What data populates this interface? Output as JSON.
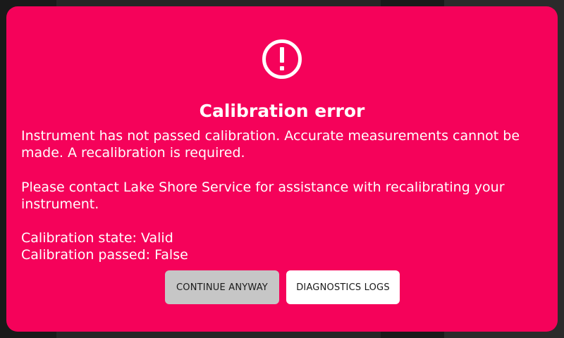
{
  "dialog": {
    "icon": "alert-circle-icon",
    "title": "Calibration error",
    "message_line1": "Instrument has not passed calibration. Accurate measurements cannot be made. A recalibration is required.",
    "message_line2": "Please contact Lake Shore Service for assistance with recalibrating your instrument.",
    "calibration_state": "Calibration state: Valid",
    "calibration_passed": "Calibration passed: False",
    "buttons": {
      "continue_label": "CONTINUE ANYWAY",
      "diagnostics_label": "DIAGNOSTICS LOGS"
    }
  },
  "colors": {
    "dialog_background": "#f5025a",
    "text": "#ffffff",
    "continue_button": "#c6c6c6",
    "diagnostics_button": "#ffffff"
  }
}
